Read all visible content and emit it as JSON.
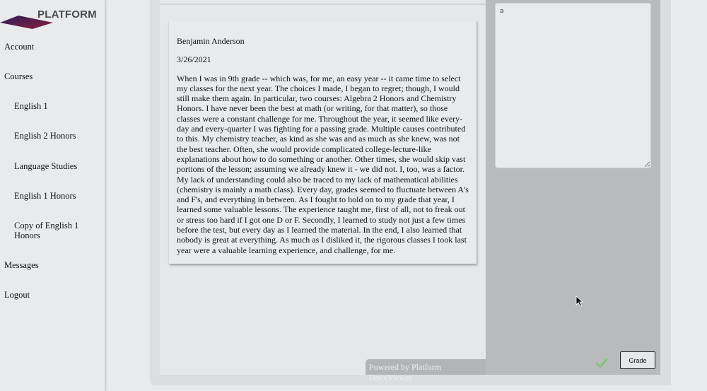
{
  "brand": {
    "name": "PLATFORM"
  },
  "sidebar": {
    "items": [
      {
        "label": "Account",
        "level": "top"
      },
      {
        "label": "Courses",
        "level": "top"
      },
      {
        "label": "English 1",
        "level": "sub"
      },
      {
        "label": "English 2 Honors",
        "level": "sub"
      },
      {
        "label": "Language Studies",
        "level": "sub"
      },
      {
        "label": "English 1 Honors",
        "level": "sub"
      },
      {
        "label": "Copy of English 1 Honors",
        "level": "sub"
      },
      {
        "label": "Messages",
        "level": "top"
      },
      {
        "label": "Logout",
        "level": "top"
      }
    ]
  },
  "document": {
    "author": "Benjamin Anderson",
    "date": "3/26/2021",
    "body": "When I was in 9th grade -- which was, for me, an easy year -- it came time to select my classes for the next year. The choices I made, I began to regret; though, I would still make them again. In particular, two courses: Algebra 2 Honors and Chemistry Honors. I have never been the best at math (or writing, for that matter), so those classes were a constant challenge for me. Throughout the year, it seemed like every-day and every-quarter I was fighting for a passing grade. Multiple causes contributed to this. My chemistry teacher, as kind as she was and as much as she knew, was not the best teacher. Often, she would provide complicated college-lecture-like explanations about how to do something or another. Other times, she would skip vast portions of the lesson; assuming we already knew it - we did not. I, too, was a factor. My lack of understanding could also be traced to my lack of mathematical abilities (chemistry is mainly a math class). Every day, grades seemed to fluctuate between A's and F's, and everything in between. As I fought to hold on to my grade that year, I learned some valuable lessons. The experience taught me, first of all, not to freak out or stress too hard if I got one D or F. Secondly, I learned to study not just a few times before the test, but every day as I learned the material. In the end, I also learned that nobody is great at everything. As much as I disliked it, the rigorous classes I took last year were a valuable learning experience, and challenge, for me.",
    "viewer_credit": "Powered by Platform DocxViewer"
  },
  "grading": {
    "feedback_value": "a",
    "grade_button_label": "Grade",
    "status_icon": "check-icon",
    "status_color": "#7cc576"
  },
  "colors": {
    "logo_gradient_start": "#2a1f5c",
    "logo_gradient_end": "#8a1f3a"
  }
}
